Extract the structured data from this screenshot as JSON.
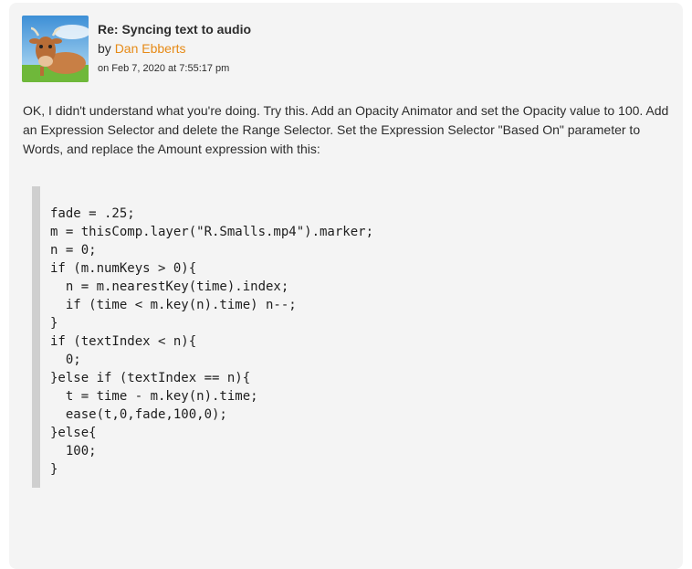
{
  "post": {
    "title": "Re: Syncing text to audio",
    "by_prefix": "by ",
    "author": "Dan Ebberts",
    "date": "on Feb 7, 2020 at 7:55:17 pm",
    "body": "OK, I didn't understand what you're doing. Try this. Add an Opacity Animator and set the Opacity value to 100. Add an Expression Selector and delete the Range Selector. Set the Expression Selector \"Based On\" parameter to Words, and replace the Amount expression with this:",
    "code": "fade = .25;\nm = thisComp.layer(\"R.Smalls.mp4\").marker;\nn = 0;\nif (m.numKeys > 0){\n  n = m.nearestKey(time).index;\n  if (time < m.key(n).time) n--;\n}\nif (textIndex < n){\n  0;\n}else if (textIndex == n){\n  t = time - m.key(n).time;\n  ease(t,0,fade,100,0);\n}else{\n  100;\n}"
  },
  "colors": {
    "author_link": "#e68a16",
    "card_bg": "#f4f4f4",
    "code_bar": "#cfcfcf"
  },
  "avatar_icon": "cow-avatar"
}
